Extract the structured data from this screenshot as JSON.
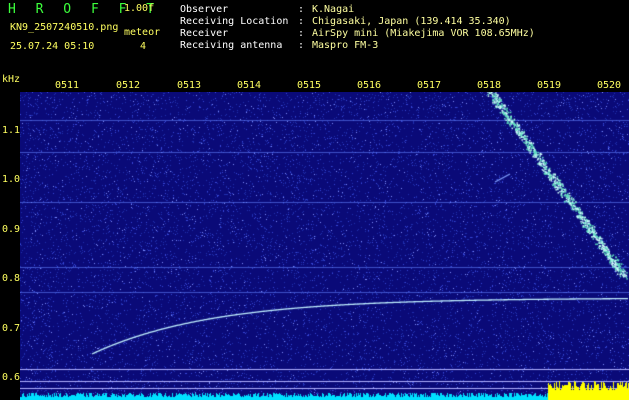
{
  "header": {
    "logo": "H R O F F T",
    "version": "1.00f",
    "filename": "KN9_2507240510.png",
    "meteor_label": "meteor",
    "meteor_count": "4",
    "timestamp": "25.07.24 05:10",
    "info": [
      {
        "key": "Observer",
        "value": "K.Nagai"
      },
      {
        "key": "Receiving Location",
        "value": "Chigasaki, Japan (139.414 35.340)"
      },
      {
        "key": "Receiver",
        "value": "AirSpy mini (Miakejima VOR 108.65MHz)"
      },
      {
        "key": "Receiving antenna",
        "value": "Maspro FM-3"
      }
    ]
  },
  "plot": {
    "y_unit": "kHz",
    "y_ticks": [
      "1.1",
      "1.0",
      "0.9",
      "0.8",
      "0.7",
      "0.6"
    ],
    "x_ticks": [
      "0511",
      "0512",
      "0513",
      "0514",
      "0515",
      "0516",
      "0517",
      "0518",
      "0519",
      "0520"
    ],
    "colors": {
      "background": "#0a0a78",
      "noise": "#3040d0",
      "signal": "#c0f0ff",
      "tick_text": "#ffff60",
      "baseline": "#00e0ff",
      "peak": "#ffff00"
    }
  }
}
